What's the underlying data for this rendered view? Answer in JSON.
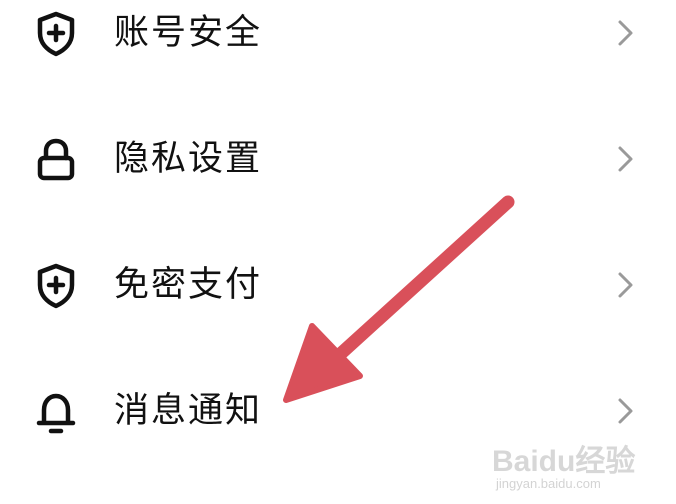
{
  "menu": {
    "items": [
      {
        "label": "账号安全",
        "icon": "shield-plus-icon"
      },
      {
        "label": "隐私设置",
        "icon": "lock-icon"
      },
      {
        "label": "免密支付",
        "icon": "shield-plus-icon"
      },
      {
        "label": "消息通知",
        "icon": "bell-icon"
      }
    ]
  },
  "annotation": {
    "arrow_color": "#d9505a"
  },
  "watermark": {
    "logo": "Baidu经验",
    "url": "jingyan.baidu.com"
  }
}
